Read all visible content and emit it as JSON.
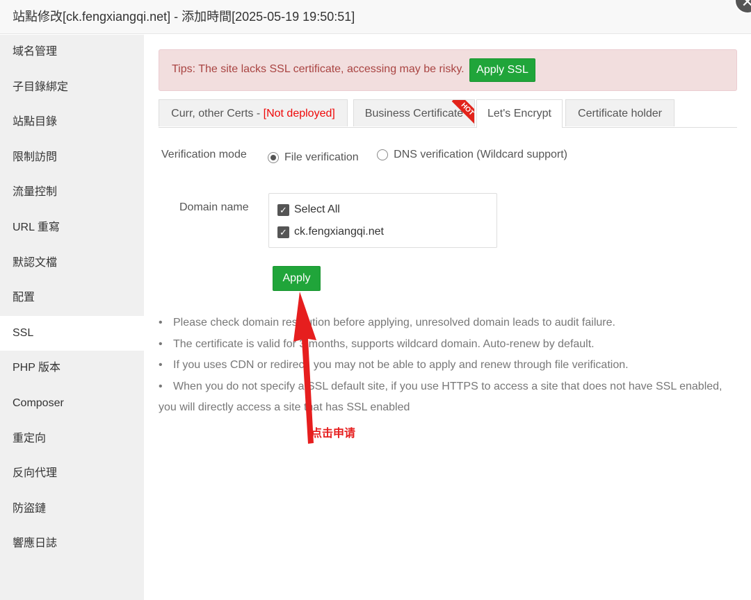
{
  "window": {
    "title": "站點修改[ck.fengxiangqi.net] - 添加時間[2025-05-19 19:50:51]",
    "close_glyph": "✕"
  },
  "sidebar": {
    "items": [
      {
        "label": "域名管理"
      },
      {
        "label": "子目錄綁定"
      },
      {
        "label": "站點目錄"
      },
      {
        "label": "限制訪問"
      },
      {
        "label": "流量控制"
      },
      {
        "label": "URL 重寫"
      },
      {
        "label": "默認文檔"
      },
      {
        "label": "配置"
      },
      {
        "label": "SSL",
        "active": true
      },
      {
        "label": "PHP 版本"
      },
      {
        "label": "Composer"
      },
      {
        "label": "重定向"
      },
      {
        "label": "反向代理"
      },
      {
        "label": "防盜鏈"
      },
      {
        "label": "響應日誌"
      }
    ]
  },
  "alert": {
    "text": "Tips: The site lacks SSL certificate, accessing may be risky.",
    "button_label": "Apply SSL"
  },
  "tabs": {
    "curr_label": "Curr, other Certs - ",
    "curr_status": "[Not deployed]",
    "business_label": "Business Certificate",
    "hot_badge": "HOT",
    "letsencrypt_label": "Let's Encrypt",
    "holder_label": "Certificate holder",
    "active": "Let's Encrypt"
  },
  "verification": {
    "label": "Verification mode",
    "options": [
      {
        "label": "File verification",
        "checked": true
      },
      {
        "label": "DNS verification (Wildcard support)",
        "checked": false
      }
    ]
  },
  "domain": {
    "label": "Domain name",
    "select_all_label": "Select All",
    "items": [
      {
        "label": "ck.fengxiangqi.net",
        "checked": true
      }
    ],
    "check_glyph": "✓"
  },
  "apply_button": {
    "label": "Apply"
  },
  "notes": {
    "bullet": "•",
    "items": [
      "Please check domain resolution before applying, unresolved domain leads to audit failure.",
      "The certificate is valid for 3 months, supports wildcard domain. Auto-renew by default.",
      "If you uses CDN or redirect, you may not be able to apply and renew through file verification.",
      "When you do not specify a SSL default site, if you use HTTPS to access a site that does not have SSL enabled, you will directly access a site that has SSL enabled"
    ]
  },
  "annotation": {
    "text": "点击申请",
    "color": "#e61e1e"
  }
}
